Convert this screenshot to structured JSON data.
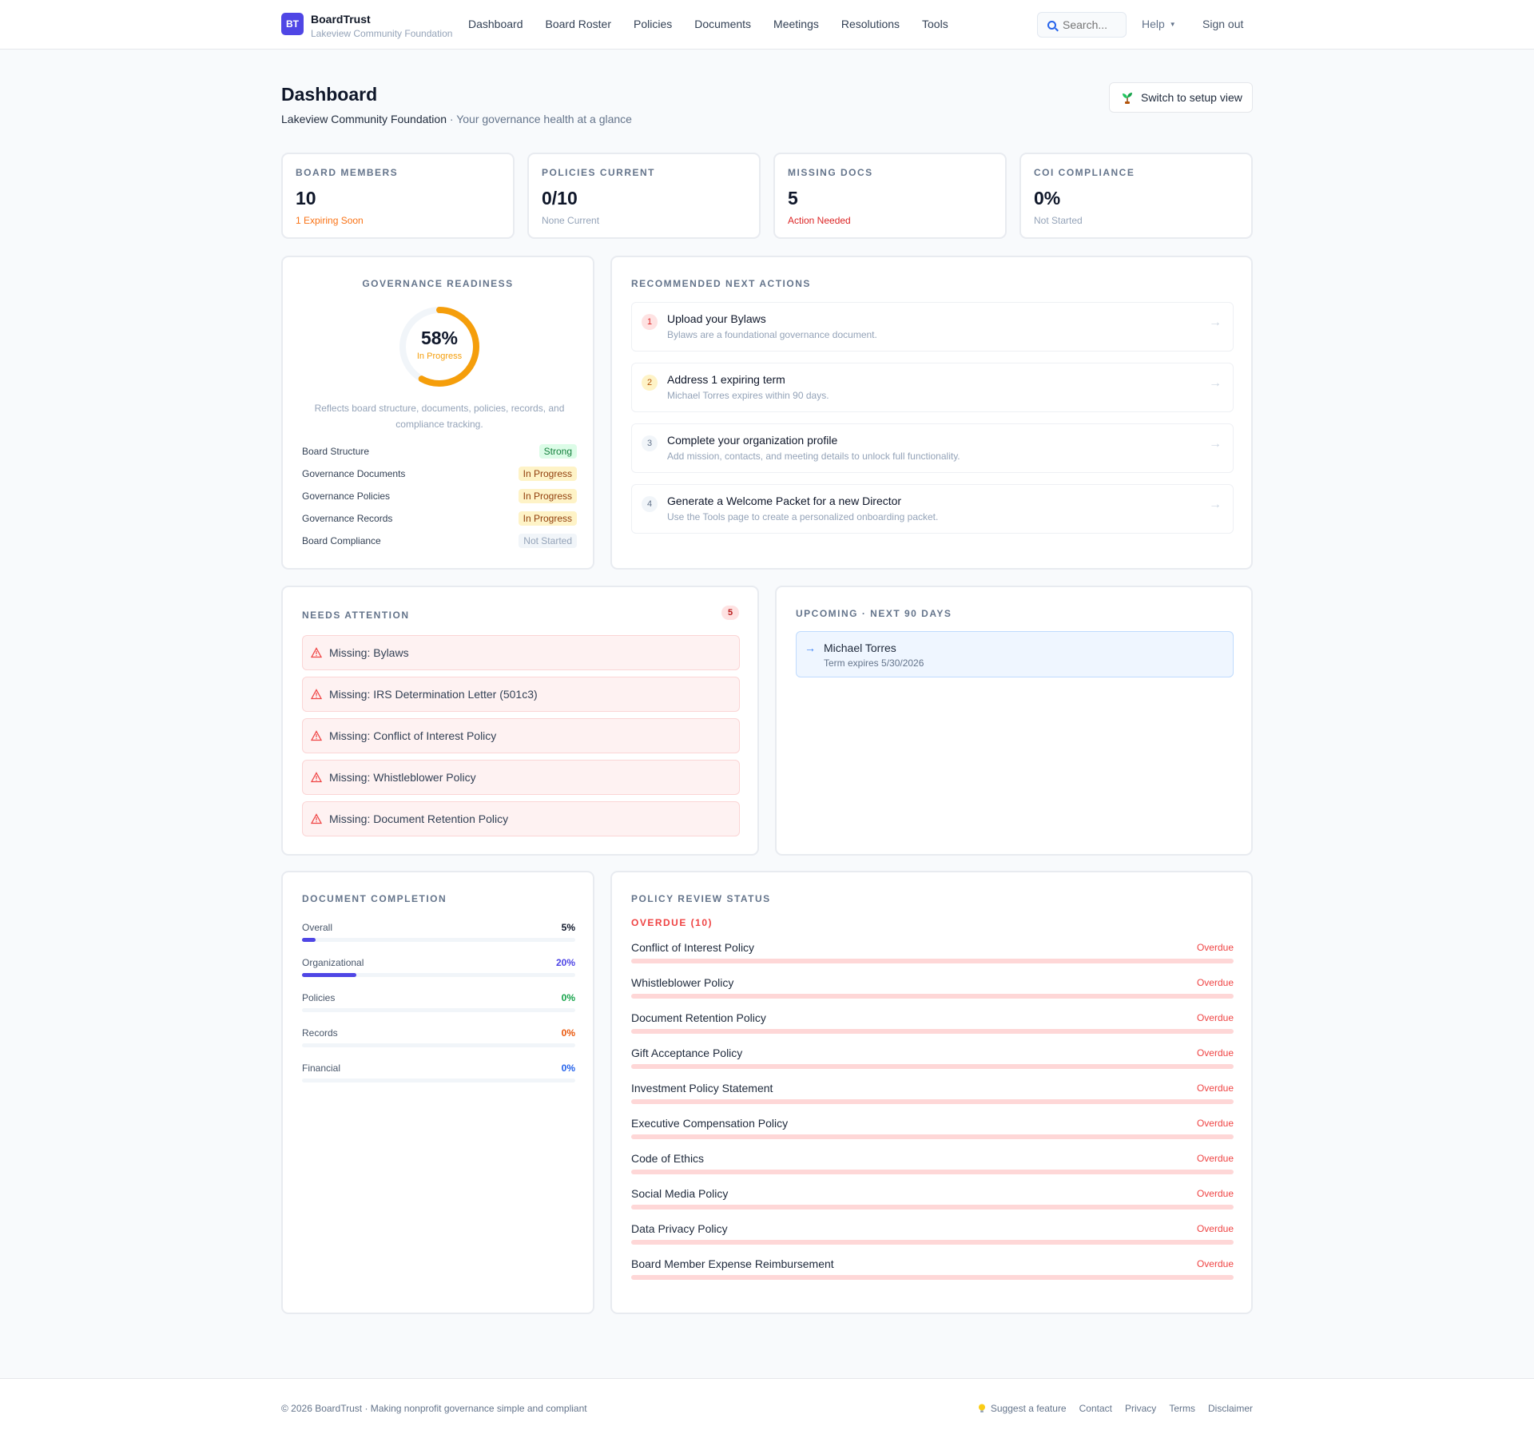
{
  "brand": {
    "logo": "BT",
    "name": "BoardTrust",
    "org": "Lakeview Community Foundation"
  },
  "nav": [
    "Dashboard",
    "Board Roster",
    "Policies",
    "Documents",
    "Meetings",
    "Resolutions",
    "Tools"
  ],
  "search": {
    "placeholder": "Search..."
  },
  "help_label": "Help",
  "signout_label": "Sign out",
  "header": {
    "title": "Dashboard",
    "org": "Lakeview Community Foundation",
    "tagline": "· Your governance health at a glance",
    "setup_button": "Switch to setup view"
  },
  "stats": [
    {
      "label": "BOARD MEMBERS",
      "value": "10",
      "note": "1 Expiring Soon",
      "note_color": "#f97316"
    },
    {
      "label": "POLICIES CURRENT",
      "value": "0/10",
      "note": "None Current",
      "note_color": "#94a3b8"
    },
    {
      "label": "MISSING DOCS",
      "value": "5",
      "note": "Action Needed",
      "note_color": "#dc2626"
    },
    {
      "label": "COI COMPLIANCE",
      "value": "0%",
      "note": "Not Started",
      "note_color": "#94a3b8"
    }
  ],
  "readiness": {
    "title": "GOVERNANCE READINESS",
    "percent": 58,
    "percent_label": "58%",
    "state": "In Progress",
    "description": "Reflects board structure, documents, policies, records, and compliance tracking.",
    "items": [
      {
        "label": "Board Structure",
        "status": "Strong",
        "kind": "strong"
      },
      {
        "label": "Governance Documents",
        "status": "In Progress",
        "kind": "prog"
      },
      {
        "label": "Governance Policies",
        "status": "In Progress",
        "kind": "prog"
      },
      {
        "label": "Governance Records",
        "status": "In Progress",
        "kind": "prog"
      },
      {
        "label": "Board Compliance",
        "status": "Not Started",
        "kind": "none"
      }
    ]
  },
  "actions": {
    "title": "RECOMMENDED NEXT ACTIONS",
    "items": [
      {
        "num": "1",
        "title": "Upload your Bylaws",
        "desc": "Bylaws are a foundational governance document.",
        "num_bg": "#fee2e2",
        "num_color": "#dc2626"
      },
      {
        "num": "2",
        "title": "Address 1 expiring term",
        "desc": "Michael Torres expires within 90 days.",
        "num_bg": "#fef3c7",
        "num_color": "#b45309"
      },
      {
        "num": "3",
        "title": "Complete your organization profile",
        "desc": "Add mission, contacts, and meeting details to unlock full functionality.",
        "num_bg": "#f1f5f9",
        "num_color": "#64748b"
      },
      {
        "num": "4",
        "title": "Generate a Welcome Packet for a new Director",
        "desc": "Use the Tools page to create a personalized onboarding packet.",
        "num_bg": "#f1f5f9",
        "num_color": "#64748b"
      }
    ]
  },
  "attention": {
    "title": "NEEDS ATTENTION",
    "count": "5",
    "items": [
      "Missing: Bylaws",
      "Missing: IRS Determination Letter (501c3)",
      "Missing: Conflict of Interest Policy",
      "Missing: Whistleblower Policy",
      "Missing: Document Retention Policy"
    ]
  },
  "upcoming": {
    "title": "UPCOMING · NEXT 90 DAYS",
    "items": [
      {
        "name": "Michael Torres",
        "detail": "Term expires 5/30/2026"
      }
    ]
  },
  "doc_completion": {
    "title": "DOCUMENT COMPLETION",
    "items": [
      {
        "label": "Overall",
        "percent": 5,
        "percent_label": "5%",
        "color": "#0f172a"
      },
      {
        "label": "Organizational",
        "percent": 20,
        "percent_label": "20%",
        "color": "#4f46e5"
      },
      {
        "label": "Policies",
        "percent": 0,
        "percent_label": "0%",
        "color": "#16a34a"
      },
      {
        "label": "Records",
        "percent": 0,
        "percent_label": "0%",
        "color": "#ea580c"
      },
      {
        "label": "Financial",
        "percent": 0,
        "percent_label": "0%",
        "color": "#2563eb"
      }
    ]
  },
  "policy_review": {
    "title": "POLICY REVIEW STATUS",
    "overdue_heading": "OVERDUE (10)",
    "items": [
      {
        "name": "Conflict of Interest Policy",
        "status": "Overdue"
      },
      {
        "name": "Whistleblower Policy",
        "status": "Overdue"
      },
      {
        "name": "Document Retention Policy",
        "status": "Overdue"
      },
      {
        "name": "Gift Acceptance Policy",
        "status": "Overdue"
      },
      {
        "name": "Investment Policy Statement",
        "status": "Overdue"
      },
      {
        "name": "Executive Compensation Policy",
        "status": "Overdue"
      },
      {
        "name": "Code of Ethics",
        "status": "Overdue"
      },
      {
        "name": "Social Media Policy",
        "status": "Overdue"
      },
      {
        "name": "Data Privacy Policy",
        "status": "Overdue"
      },
      {
        "name": "Board Member Expense Reimbursement",
        "status": "Overdue"
      }
    ]
  },
  "footer": {
    "copyright": "© 2026 BoardTrust · Making nonprofit governance simple and compliant",
    "links": [
      "Suggest a feature",
      "Contact",
      "Privacy",
      "Terms",
      "Disclaimer"
    ]
  },
  "icons": {
    "search": "search-icon",
    "help_caret": "caret-down-icon",
    "setup": "sprout-icon",
    "warning": "warning-triangle-icon",
    "action_arrow": "arrow-right-icon",
    "upcoming_arrow": "arrow-right-icon",
    "suggest": "lightbulb-icon"
  }
}
